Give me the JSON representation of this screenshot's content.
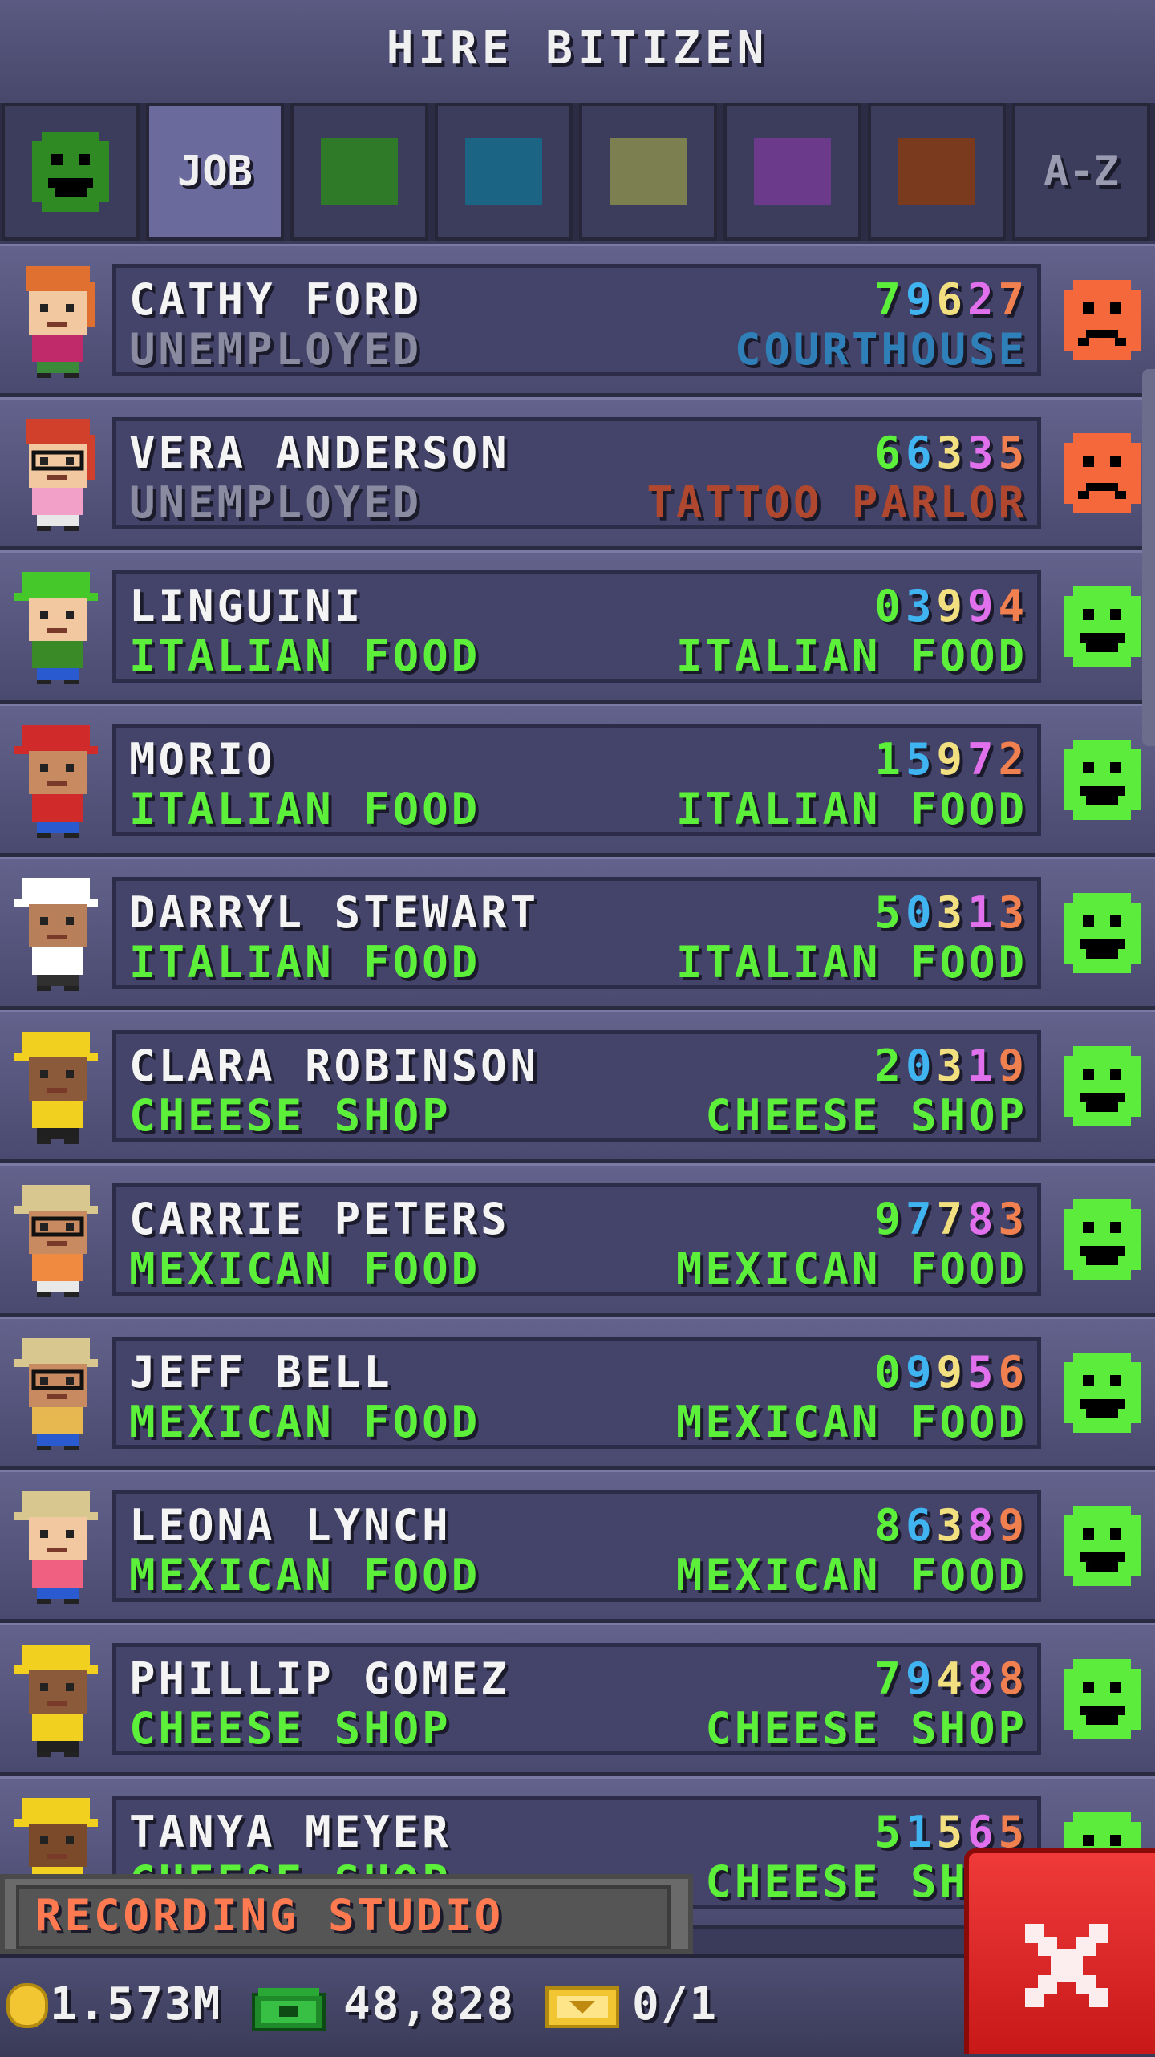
{
  "title": "HIRE BITIZEN",
  "tabs": [
    {
      "kind": "icon",
      "icon": "happy-face-icon",
      "color": "#2f8a24"
    },
    {
      "kind": "text",
      "label": "JOB",
      "active": true
    },
    {
      "kind": "swatch",
      "color": "#2f7a28"
    },
    {
      "kind": "swatch",
      "color": "#1c6484"
    },
    {
      "kind": "swatch",
      "color": "#7c8050"
    },
    {
      "kind": "swatch",
      "color": "#6c3a8a"
    },
    {
      "kind": "swatch",
      "color": "#7a3a1e"
    },
    {
      "kind": "text",
      "label": "A-Z",
      "dim": true
    }
  ],
  "digit_colors": [
    "#5cf03a",
    "#3fb4f0",
    "#f2e080",
    "#e070ec",
    "#f08050"
  ],
  "rows": [
    {
      "name": "CATHY FORD",
      "job": "UNEMPLOYED",
      "job_color": "#8a8aa0",
      "stats": "79627",
      "place": "COURTHOUSE",
      "place_color": "#2f80b8",
      "mood": "sad"
    },
    {
      "name": "VERA ANDERSON",
      "job": "UNEMPLOYED",
      "job_color": "#8a8aa0",
      "stats": "66335",
      "place": "TATTOO PARLOR",
      "place_color": "#b04830",
      "mood": "sad"
    },
    {
      "name": "LINGUINI",
      "job": "ITALIAN FOOD",
      "job_color": "#5cf03a",
      "stats": "03994",
      "place": "ITALIAN FOOD",
      "place_color": "#5cf03a",
      "mood": "happy"
    },
    {
      "name": "MORIO",
      "job": "ITALIAN FOOD",
      "job_color": "#5cf03a",
      "stats": "15972",
      "place": "ITALIAN FOOD",
      "place_color": "#5cf03a",
      "mood": "happy"
    },
    {
      "name": "DARRYL STEWART",
      "job": "ITALIAN FOOD",
      "job_color": "#5cf03a",
      "stats": "50313",
      "place": "ITALIAN FOOD",
      "place_color": "#5cf03a",
      "mood": "happy"
    },
    {
      "name": "CLARA ROBINSON",
      "job": "CHEESE SHOP",
      "job_color": "#5cf03a",
      "stats": "20319",
      "place": "CHEESE SHOP",
      "place_color": "#5cf03a",
      "mood": "happy"
    },
    {
      "name": "CARRIE PETERS",
      "job": "MEXICAN FOOD",
      "job_color": "#5cf03a",
      "stats": "97783",
      "place": "MEXICAN FOOD",
      "place_color": "#5cf03a",
      "mood": "happy"
    },
    {
      "name": "JEFF BELL",
      "job": "MEXICAN FOOD",
      "job_color": "#5cf03a",
      "stats": "09956",
      "place": "MEXICAN FOOD",
      "place_color": "#5cf03a",
      "mood": "happy"
    },
    {
      "name": "LEONA LYNCH",
      "job": "MEXICAN FOOD",
      "job_color": "#5cf03a",
      "stats": "86389",
      "place": "MEXICAN FOOD",
      "place_color": "#5cf03a",
      "mood": "happy"
    },
    {
      "name": "PHILLIP GOMEZ",
      "job": "CHEESE SHOP",
      "job_color": "#5cf03a",
      "stats": "79488",
      "place": "CHEESE SHOP",
      "place_color": "#5cf03a",
      "mood": "happy"
    },
    {
      "name": "TANYA MEYER",
      "job": "CHEESE SHOP",
      "job_color": "#5cf03a",
      "stats": "51565",
      "place": "CHEESE SHOP",
      "place_color": "#5cf03a",
      "mood": "happy"
    }
  ],
  "colors": {
    "sad_face": "#f4683c",
    "happy_face": "#5ced3c"
  },
  "building": {
    "label": "RECORDING STUDIO"
  },
  "currency": {
    "coins": "1.573M",
    "bux": "48,828",
    "tickets": "0/1"
  },
  "close_icon": "close-x-icon"
}
